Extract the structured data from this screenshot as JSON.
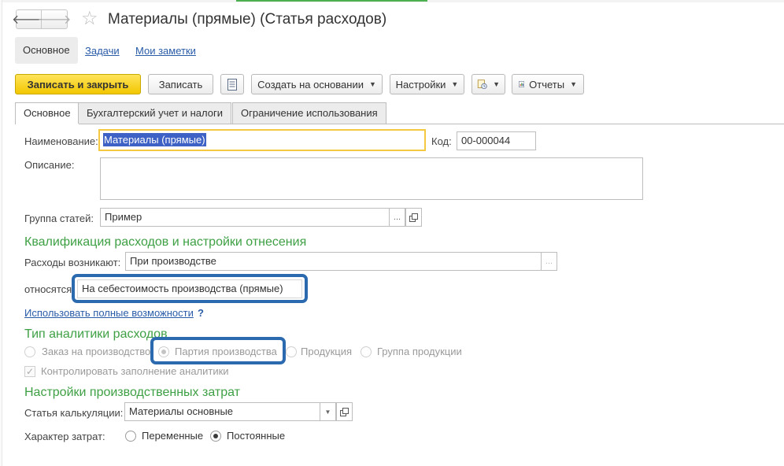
{
  "window": {
    "title": "Материалы (прямые) (Статья расходов)",
    "back_icon": "arrow-left-icon",
    "forward_icon": "arrow-right-icon",
    "favorite_icon": "star-icon"
  },
  "section_tabs": [
    {
      "label": "Основное",
      "active": true
    },
    {
      "label": "Задачи",
      "active": false
    },
    {
      "label": "Мои заметки",
      "active": false
    }
  ],
  "toolbar": {
    "save_close": "Записать и закрыть",
    "save": "Записать",
    "list_icon": "document-list-icon",
    "create_based": "Создать на основании",
    "settings": "Настройки",
    "attach_icon": "attachments-icon",
    "reports": "Отчеты",
    "reports_icon": "report-icon"
  },
  "tabs": [
    "Основное",
    "Бухгалтерский учет и налоги",
    "Ограничение использования"
  ],
  "form": {
    "name_label": "Наименование:",
    "name_value": "Материалы (прямые)",
    "code_label": "Код:",
    "code_value": "00-000044",
    "description_label": "Описание:",
    "description_value": "",
    "group_label": "Группа статей:",
    "group_value": "Пример"
  },
  "qualification": {
    "heading": "Квалификация расходов и настройки отнесения",
    "arise_label": "Расходы возникают:",
    "arise_value": "При производстве",
    "attributed_label": "относятся",
    "attributed_value": "На себестоимость производства (прямые)",
    "full_link": "Использовать полные возможности",
    "help": "?"
  },
  "analytics": {
    "heading": "Тип аналитики расходов",
    "options": [
      {
        "label": "Заказ на производство",
        "selected": false
      },
      {
        "label": "Партия производства",
        "selected": true
      },
      {
        "label": "Продукция",
        "selected": false
      },
      {
        "label": "Группа продукции",
        "selected": false
      }
    ],
    "control_label": "Контролировать заполнение аналитики",
    "control_checked": true
  },
  "production": {
    "heading": "Настройки производственных затрат",
    "calc_label": "Статья калькуляции:",
    "calc_value": "Материалы основные",
    "nature_label": "Характер затрат:",
    "nature_options": [
      {
        "label": "Переменные",
        "selected": false
      },
      {
        "label": "Постоянные",
        "selected": true
      }
    ]
  },
  "colors": {
    "accent_green": "#3ea044",
    "primary_button": "#f2c600",
    "highlight_frame": "#2c6ab0",
    "link": "#2a5ca8"
  }
}
